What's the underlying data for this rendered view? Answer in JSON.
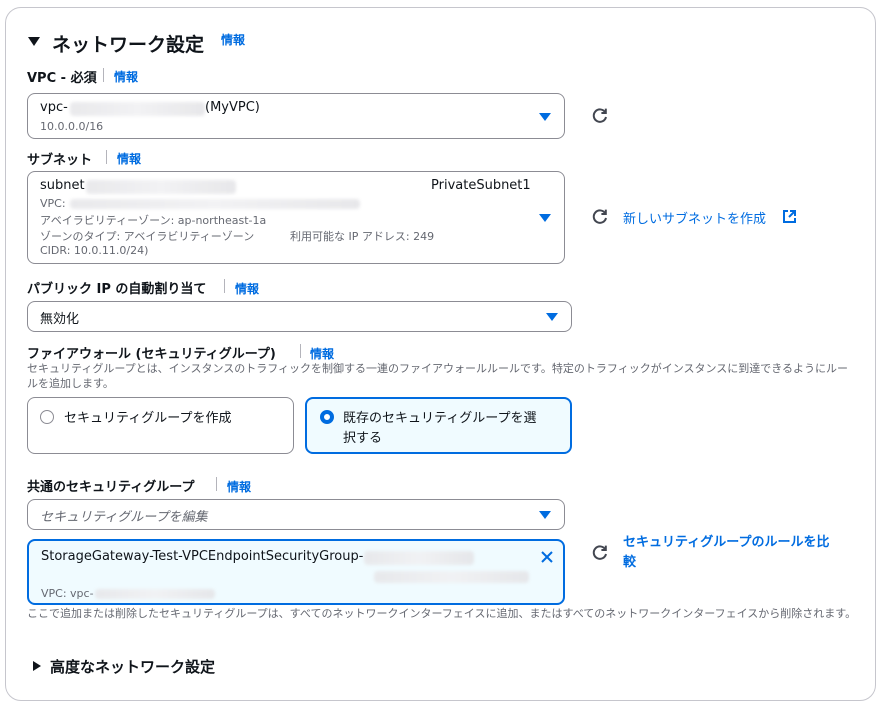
{
  "section": {
    "title": "ネットワーク設定",
    "info": "情報"
  },
  "vpc": {
    "label": "VPC - 必須",
    "info": "情報",
    "value_prefix": "vpc-",
    "value_suffix": "(MyVPC)",
    "cidr": "10.0.0.0/16"
  },
  "subnet": {
    "label": "サブネット",
    "info": "情報",
    "value_prefix": "subnet",
    "name": "PrivateSubnet1",
    "vpc_prefix": "VPC:",
    "az": "アベイラビリティーゾーン: ap-northeast-1a",
    "zone_type": "ゾーンのタイプ: アベイラビリティーゾーン",
    "ip_available": "利用可能な IP アドレス: 249",
    "cidr": "CIDR: 10.0.11.0/24)",
    "create_link": "新しいサブネットを作成"
  },
  "public_ip": {
    "label": "パブリック IP の自動割り当て",
    "info": "情報",
    "value": "無効化"
  },
  "firewall": {
    "label": "ファイアウォール (セキュリティグループ)",
    "info": "情報",
    "description": "セキュリティグループとは、インスタンスのトラフィックを制御する一連のファイアウォールルールです。特定のトラフィックがインスタンスに到達できるようにルールを追加します。",
    "option_create": "セキュリティグループを作成",
    "option_existing_line1": "既存のセキュリティグループを選",
    "option_existing_line2": "択する"
  },
  "common_sg": {
    "label": "共通のセキュリティグループ",
    "info": "情報",
    "placeholder": "セキュリティグループを編集",
    "token_name": "StorageGateway-Test-VPCEndpointSecurityGroup-",
    "token_vpc": "VPC: vpc-",
    "compare_link_line1": "セキュリティグループのルールを比",
    "compare_link_line2": "較",
    "note": "ここで追加または削除したセキュリティグループは、すべてのネットワークインターフェイスに追加、またはすべてのネットワークインターフェイスから削除されます。"
  },
  "advanced": {
    "title": "高度なネットワーク設定"
  },
  "colors": {
    "accent": "#006ce0",
    "border": "#8c8c94",
    "text": "#0f141a",
    "muted": "#656871"
  }
}
